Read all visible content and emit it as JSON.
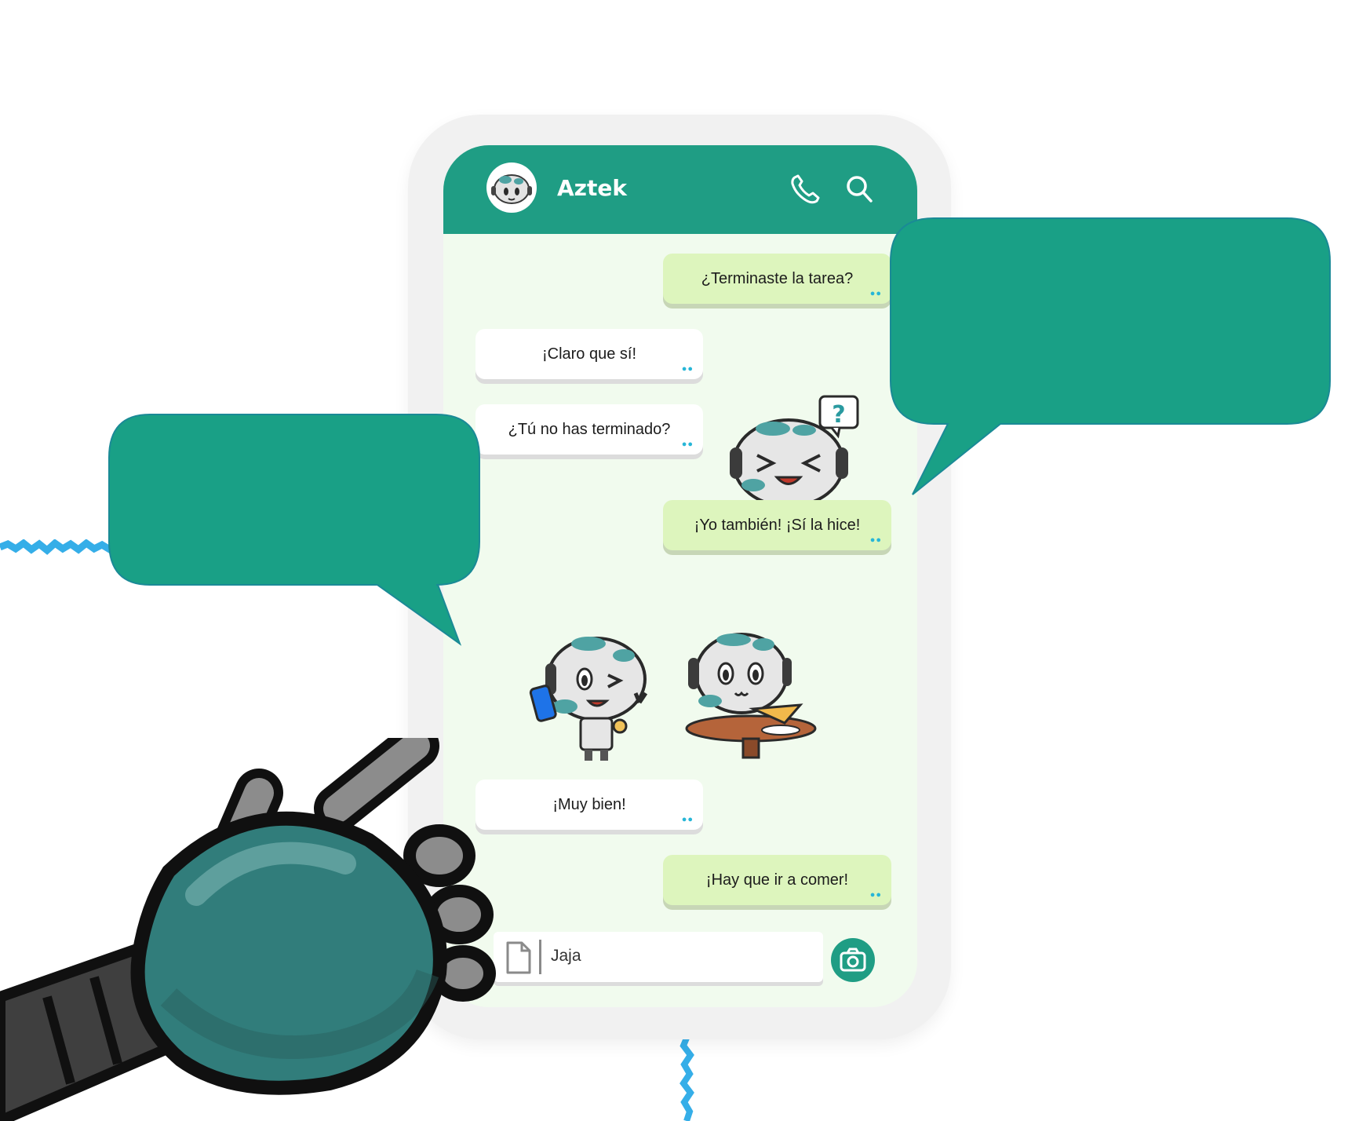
{
  "chat": {
    "contact_name": "Aztek",
    "messages": [
      {
        "direction": "out",
        "text": "¿Terminaste la tarea?"
      },
      {
        "direction": "in",
        "text": "¡Claro que sí!"
      },
      {
        "direction": "in",
        "text": "¿Tú no has terminado?"
      },
      {
        "direction": "sticker",
        "icon": "robot-question-sticker"
      },
      {
        "direction": "out",
        "text": "¡Yo también! ¡Sí la hice!"
      },
      {
        "direction": "sticker",
        "icon": "robot-phone-sticker"
      },
      {
        "direction": "sticker",
        "icon": "robot-pizza-sticker"
      },
      {
        "direction": "in",
        "text": "¡Muy bien!"
      },
      {
        "direction": "out",
        "text": "¡Hay que ir a comer!"
      }
    ],
    "input": {
      "value": "Jaja"
    }
  },
  "colors": {
    "brand": "#1f9d84",
    "outgoing_bubble": "#ddf5bd",
    "chat_background": "#f1fbee",
    "read_ticks": "#27b6d7",
    "scribble": "#35aee8"
  },
  "icons": {
    "call": "phone-icon",
    "search": "search-icon",
    "attach": "file-icon",
    "camera": "camera-icon"
  }
}
